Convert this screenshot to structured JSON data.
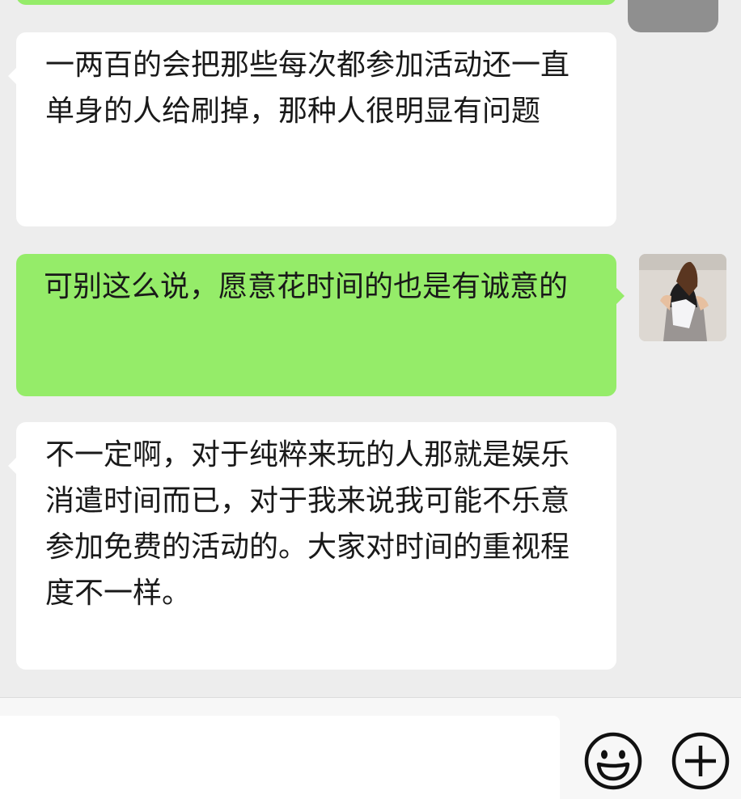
{
  "chat": {
    "messages": [
      {
        "side": "left",
        "text": "一两百的会把那些每次都参加活动还一直单身的人给刷掉，那种人很明显有问题"
      },
      {
        "side": "right",
        "text": "可别这么说，愿意花时间的也是有诚意的"
      },
      {
        "side": "left",
        "text": "不一定啊，对于纯粹来玩的人那就是娱乐消遣时间而已，对于我来说我可能不乐意参加免费的活动的。大家对时间的重视程度不一样。"
      }
    ]
  },
  "colors": {
    "background": "#ededed",
    "incoming_bubble": "#ffffff",
    "outgoing_bubble": "#95ec69",
    "text": "#191919"
  },
  "input_bar": {
    "icons": [
      "emoji-icon",
      "plus-icon"
    ]
  }
}
